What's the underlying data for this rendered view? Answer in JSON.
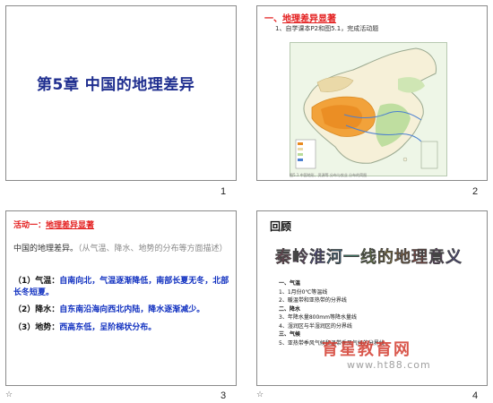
{
  "slides": [
    {
      "number": "1",
      "title": "第5章 中国的地理差异"
    },
    {
      "number": "2",
      "heading_prefix": "一、",
      "heading_link": "地理差异显著",
      "subtext": "1、自学课本P2和图5.1，完成活动题",
      "map_caption": "图5.1 中国地形、资源等 分布与农业 分布的简图"
    },
    {
      "number": "3",
      "activity_prefix": "活动一：",
      "activity_link": "地理差异显著",
      "intro_text": "中国的地理差异。",
      "intro_hint": "（从气温、降水、地势的分布等方面描述）",
      "items": [
        {
          "label": "（1）气温：",
          "text": "自南向北，气温逐渐降低，南部长夏无冬，北部长冬短夏。"
        },
        {
          "label": "（2）降水：",
          "text": "自东南沿海向西北内陆，降水逐渐减少。"
        },
        {
          "label": "（3）地势：",
          "text": "西高东低，呈阶梯状分布。"
        }
      ],
      "footer_icon": "☆"
    },
    {
      "number": "4",
      "heading": "回顾",
      "wordart": "秦岭淮河一线的地理意义",
      "list": [
        {
          "type": "sec",
          "text": "一、气温"
        },
        {
          "type": "item",
          "text": "1、1月份0℃等温线"
        },
        {
          "type": "item",
          "text": "2、暖温带和亚热带的分界线"
        },
        {
          "type": "sec",
          "text": "二、降水"
        },
        {
          "type": "item",
          "text": "3、年降水量800mm等降水量线"
        },
        {
          "type": "item",
          "text": "4、湿润区与半湿润区的分界线"
        },
        {
          "type": "sec",
          "text": "三、气候"
        },
        {
          "type": "item",
          "text": "5、亚热带季风气候和温带季风气候的分界线"
        }
      ],
      "watermark_cn": "育星教育网",
      "watermark_url": "www.ht88.com",
      "footer_icon": "☆"
    }
  ],
  "colors": {
    "title_blue": "#1f2e8f",
    "heading_red": "#e31b1b",
    "answer_blue": "#1030c0"
  }
}
